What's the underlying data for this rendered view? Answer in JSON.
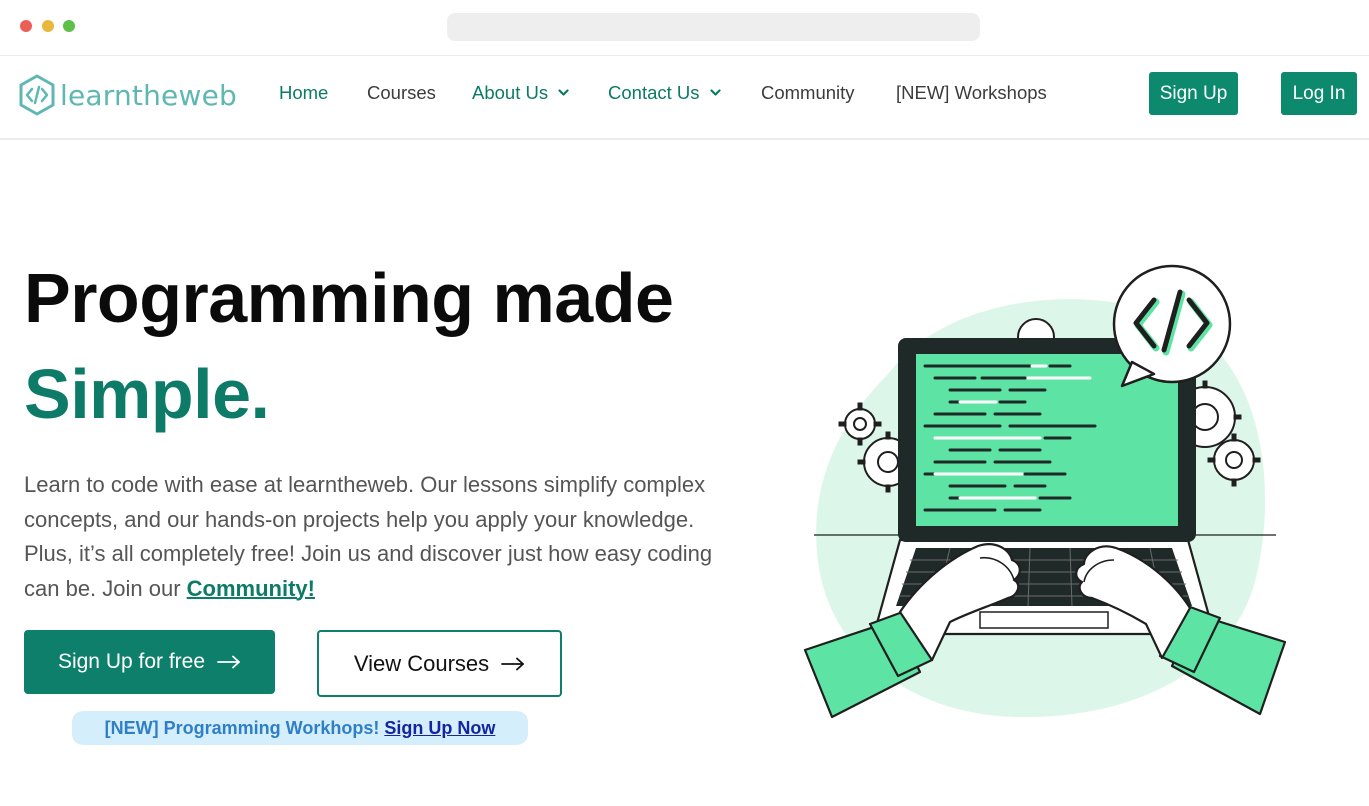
{
  "nav": {
    "brand": "learntheweb",
    "links": [
      {
        "label": "Home"
      },
      {
        "label": "Courses"
      },
      {
        "label": "About Us"
      },
      {
        "label": "Contact Us"
      },
      {
        "label": "Community"
      },
      {
        "label": "[NEW] Workshops"
      }
    ],
    "signup_label": "Sign Up",
    "login_label": "Log In"
  },
  "hero": {
    "title_line1": "Programming made",
    "title_line2": "Simple.",
    "description": "Learn to code with ease at learntheweb. Our lessons simplify complex concepts, and our hands-on projects help you apply your knowledge. Plus, it’s all completely free! Join us and discover just how easy coding can be. Join our",
    "community_link": "Community!",
    "primary_cta": "Sign Up for free",
    "secondary_cta": "View Courses",
    "promo_text": "[NEW] Programming Workhops!",
    "promo_link": "Sign Up Now"
  },
  "icons": {
    "logo": "code-brackets-hexagon-icon",
    "dropdown": "chevron-down-icon",
    "cta_arrow": "arrow-right-icon",
    "illustration": "laptop-coding-illustration"
  },
  "colors": {
    "brand_teal": "#0d7f6b",
    "logo_teal": "#5fb7b3",
    "illustration_green": "#5de4a4",
    "promo_bg": "#d5eefc",
    "promo_text": "#2f7fc6",
    "promo_link": "#1326a0"
  }
}
